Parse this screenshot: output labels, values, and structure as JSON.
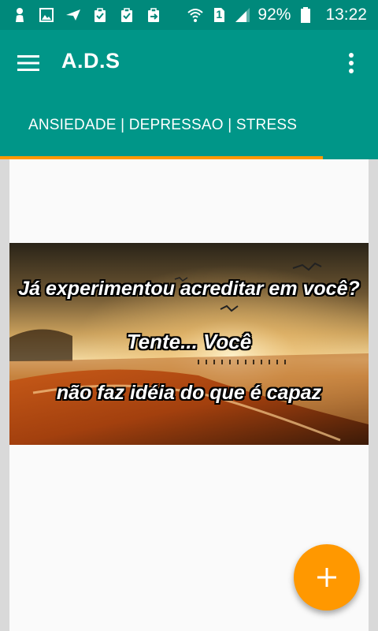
{
  "status_bar": {
    "battery_percent": "92%",
    "time": "13:22",
    "sim_slot": "1",
    "icons": [
      "person-icon",
      "image-icon",
      "send-icon",
      "clipboard-icon",
      "clipboard-check-icon",
      "clipboard-arrow-icon",
      "wifi-icon",
      "sim-icon",
      "signal-icon",
      "battery-icon"
    ]
  },
  "app_bar": {
    "title": "A.D.S",
    "menu_icon": "hamburger-menu-icon",
    "overflow_icon": "more-vert-icon"
  },
  "tabs": [
    {
      "label": "ANSIEDADE | DEPRESSAO | STRESS",
      "selected": true
    }
  ],
  "banner": {
    "line1": "Já experimentou acreditar em você?",
    "line2": "Tente... Você",
    "line3": "não faz idéia do que é capaz"
  },
  "fab": {
    "icon": "plus-icon"
  },
  "colors": {
    "primary": "#009688",
    "status_bar": "#00897b",
    "accent": "#ff9800",
    "background": "#fafafa"
  }
}
